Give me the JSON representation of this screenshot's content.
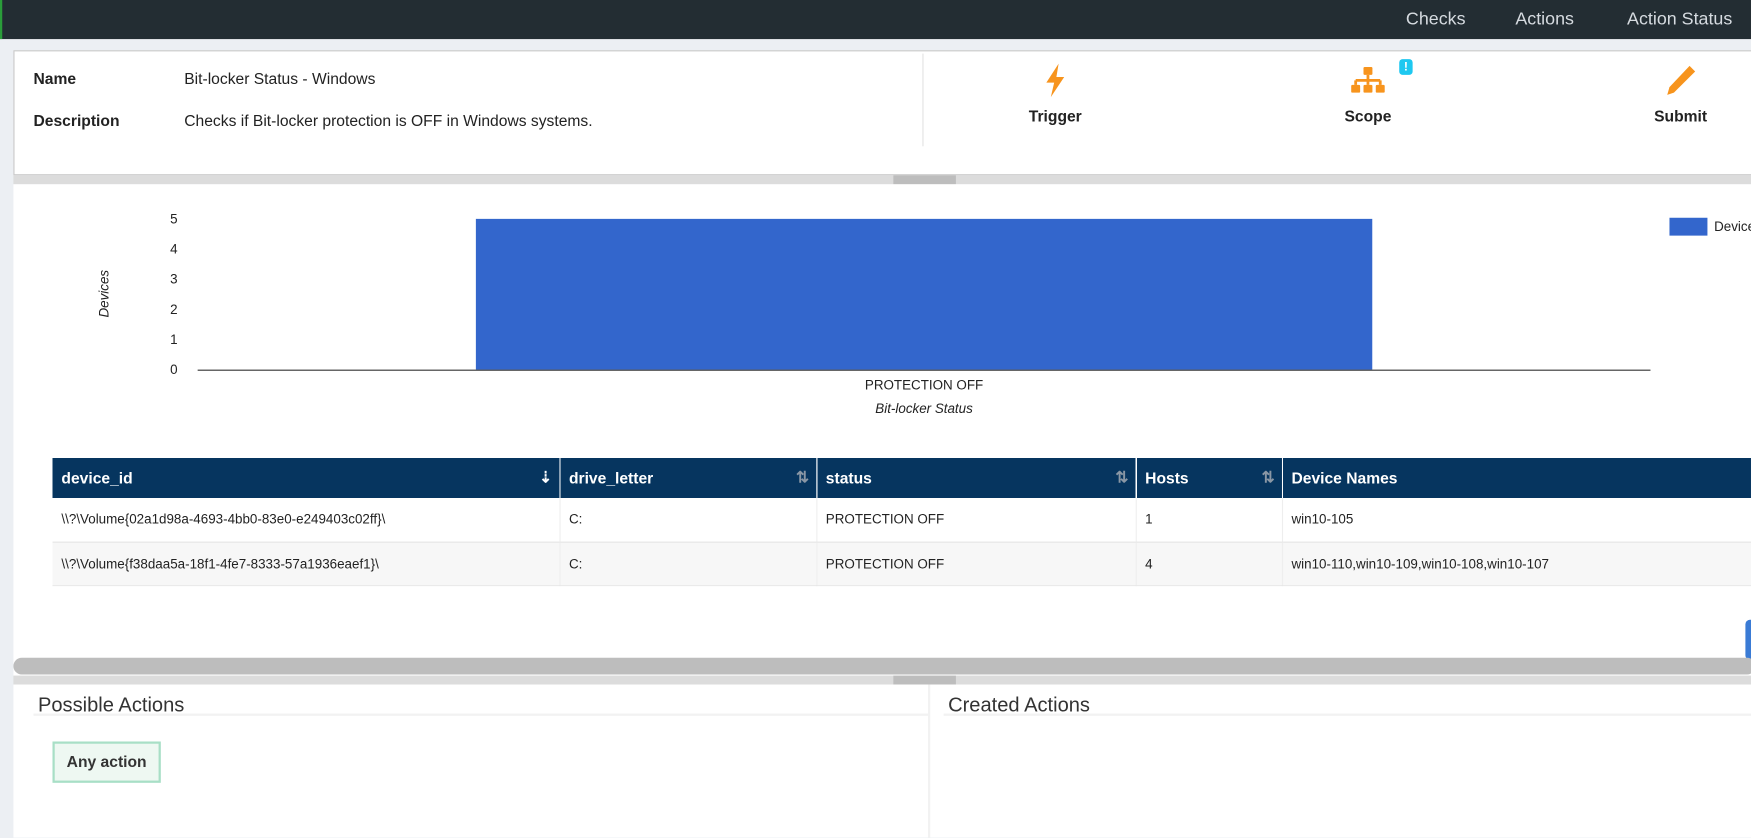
{
  "nav": {
    "items": [
      "Checks",
      "Actions",
      "Action Status"
    ]
  },
  "info": {
    "name_label": "Name",
    "name_value": "Bit-locker Status - Windows",
    "description_label": "Description",
    "description_value": "Checks if Bit-locker protection is OFF in Windows systems."
  },
  "actions": {
    "trigger": "Trigger",
    "scope": "Scope",
    "scope_badge": "!",
    "submit": "Submit"
  },
  "colors": {
    "nav": "#232d33",
    "accent": "#f7941d",
    "bar": "#3366cc",
    "table_header": "#06355f",
    "badge": "#1ec8f0"
  },
  "chart_data": {
    "type": "bar",
    "categories": [
      "PROTECTION OFF"
    ],
    "series": [
      {
        "name": "Devices",
        "values": [
          5
        ]
      }
    ],
    "xlabel": "Bit-locker Status",
    "ylabel": "Devices",
    "ylim": [
      0,
      5
    ],
    "yticks": [
      "0",
      "1",
      "2",
      "3",
      "4",
      "5"
    ],
    "legend": {
      "label": "Devices",
      "placement": "top-right"
    }
  },
  "table": {
    "headers": [
      "device_id",
      "drive_letter",
      "status",
      "Hosts",
      "Device Names"
    ],
    "rows": [
      [
        "\\\\?\\Volume{02a1d98a-4693-4bb0-83e0-e249403c02ff}\\",
        "C:",
        "PROTECTION OFF",
        "1",
        "win10-105"
      ],
      [
        "\\\\?\\Volume{f38daa5a-18f1-4fe7-8333-57a1936eaef1}\\",
        "C:",
        "PROTECTION OFF",
        "4",
        "win10-110,win10-109,win10-108,win10-107"
      ]
    ]
  },
  "possible_actions": {
    "title": "Possible Actions",
    "items": [
      "Any action"
    ]
  },
  "created_actions": {
    "title": "Created Actions"
  }
}
